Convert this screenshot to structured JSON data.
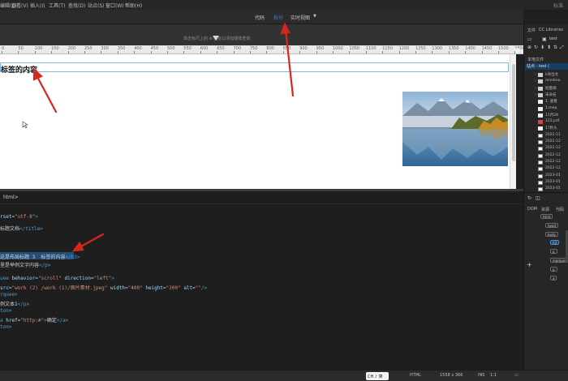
{
  "menu": {
    "items": [
      "编辑(E)",
      "查看(V)",
      "插入(I)",
      "工具(T)",
      "查找(D)",
      "站点(S)",
      "窗口(W)",
      "帮助(H)"
    ],
    "right_text": "标准"
  },
  "view_switcher": {
    "code": "代码",
    "split": "拆分",
    "live": "实时视图",
    "active": "拆分"
  },
  "media_query_hint": "单击标尺上的 ⊕ 图标以添加媒体查询",
  "ruler": {
    "ticks": [
      "0",
      "50",
      "100",
      "150",
      "200",
      "250",
      "300",
      "350",
      "400",
      "450",
      "500",
      "550",
      "600",
      "650",
      "700",
      "750",
      "800",
      "850",
      "900",
      "950",
      "1000",
      "1050",
      "1100",
      "1150",
      "1200",
      "1250",
      "1300",
      "1350",
      "1400",
      "1450",
      "1500",
      "1550"
    ]
  },
  "live_view": {
    "heading_text": "标签的内容",
    "image_alt": "landscape-photo"
  },
  "code_panel": {
    "breadcrumb": "html>",
    "lines": [
      {
        "parts": [
          [
            "atn",
            "rset="
          ],
          [
            "val",
            "\"utf-8\""
          ],
          [
            "tag",
            ">"
          ]
        ]
      },
      {
        "parts": [
          [
            "txt",
            "标题文档"
          ],
          [
            "tag",
            "</title>"
          ]
        ]
      },
      {
        "parts": [
          [
            "txt",
            "这是布局标题 3  标签的内容"
          ],
          [
            "tag",
            "</h3>"
          ]
        ]
      },
      {
        "parts": [
          [
            "txt",
            "里是举例文字内容"
          ],
          [
            "tag",
            "</p>"
          ]
        ]
      },
      {
        "parts": [
          [
            "tag",
            "uee "
          ],
          [
            "atn",
            "behavior="
          ],
          [
            "val",
            "\"scroll\""
          ],
          [
            "atn",
            " direction="
          ],
          [
            "val",
            "\"left\""
          ],
          [
            "tag",
            ">"
          ]
        ]
      },
      {
        "parts": [
          [
            "atn",
            "src="
          ],
          [
            "val",
            "\"work (2) /work (1)/图片素材.jpeg\""
          ],
          [
            "atn",
            " width="
          ],
          [
            "val",
            "\"400\""
          ],
          [
            "atn",
            " height="
          ],
          [
            "val",
            "\"200\""
          ],
          [
            "atn",
            " alt="
          ],
          [
            "val",
            "\"\""
          ],
          [
            "tag",
            "/>"
          ]
        ]
      },
      {
        "parts": [
          [
            "tag",
            "rquee>"
          ]
        ]
      },
      {
        "parts": [
          [
            "txt",
            "例文本1"
          ],
          [
            "tag",
            "</p>"
          ]
        ]
      },
      {
        "parts": [
          [
            "tag",
            "ton>"
          ]
        ]
      },
      {
        "parts": [
          [
            "tag",
            "a "
          ],
          [
            "atn",
            "href="
          ],
          [
            "val",
            "\"http:#\""
          ],
          [
            "tag",
            ">"
          ],
          [
            "txt",
            "确定"
          ],
          [
            "tag",
            "</a>"
          ]
        ]
      },
      {
        "parts": [
          [
            "tag",
            "ton>"
          ]
        ]
      }
    ]
  },
  "status_bar": {
    "ime": "CH ♪ 简",
    "doc_type": "HTML",
    "size": "1558 x 366",
    "ins": "INS",
    "pos": "1:1"
  },
  "right_panel": {
    "tabs": [
      "文件",
      "CC Libraries"
    ],
    "site_dropdown": "test",
    "site_label": "站点 - test (",
    "local_files_label": "本地文件",
    "files": [
      {
        "icon": "folder",
        "name": "k导出文"
      },
      {
        "icon": "folder",
        "name": "mindma"
      },
      {
        "icon": "folder",
        "name": "批量调"
      },
      {
        "icon": "folder",
        "name": "未命名"
      },
      {
        "icon": "doc",
        "name": "1. 查看"
      },
      {
        "icon": "doc",
        "name": "1.mep"
      },
      {
        "icon": "doc",
        "name": "11月28"
      },
      {
        "icon": "pdf",
        "name": "123.pdf"
      },
      {
        "icon": "doc",
        "name": "17秒头"
      },
      {
        "icon": "img",
        "name": "2022-11"
      },
      {
        "icon": "img",
        "name": "2022-12"
      },
      {
        "icon": "img",
        "name": "2022-12"
      },
      {
        "icon": "img",
        "name": "2022-12"
      },
      {
        "icon": "img",
        "name": "2022-12"
      },
      {
        "icon": "img",
        "name": "2022-12"
      },
      {
        "icon": "img",
        "name": "2023-01"
      },
      {
        "icon": "img",
        "name": "2023-01"
      },
      {
        "icon": "img",
        "name": "2023-01"
      }
    ],
    "dom_tabs": [
      "DOM",
      "资源",
      "代码"
    ],
    "dom_nodes": [
      "html",
      "head",
      "body",
      "h3",
      "p",
      "marquee",
      "p",
      "a"
    ]
  }
}
